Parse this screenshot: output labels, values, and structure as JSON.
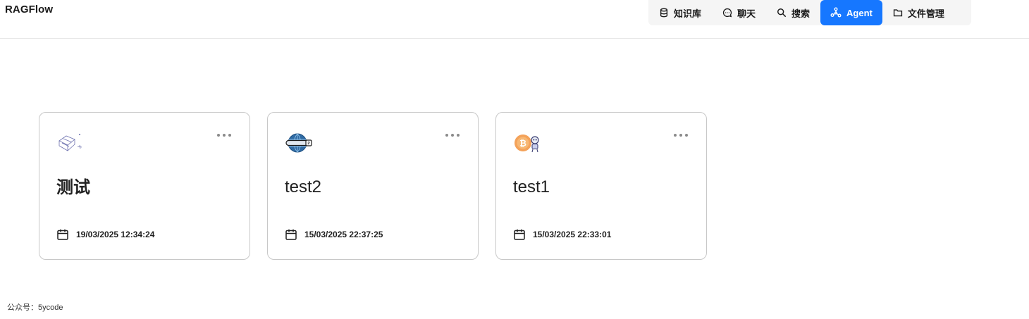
{
  "app": {
    "title": "RAGFlow"
  },
  "nav": {
    "items": [
      {
        "label": "知识库",
        "icon": "database-icon",
        "active": false
      },
      {
        "label": "聊天",
        "icon": "chat-bubble-icon",
        "active": false
      },
      {
        "label": "搜索",
        "icon": "search-icon",
        "active": false
      },
      {
        "label": "Agent",
        "icon": "agent-graph-icon",
        "active": true
      },
      {
        "label": "文件管理",
        "icon": "folder-icon",
        "active": false
      }
    ],
    "accent_color": "#1677ff"
  },
  "agents": [
    {
      "title": "测试",
      "date": "19/03/2025 12:34:24",
      "avatar": "sketch-box-avatar"
    },
    {
      "title": "test2",
      "date": "15/03/2025 22:37:25",
      "avatar": "globe-avatar"
    },
    {
      "title": "test1",
      "date": "15/03/2025 22:33:01",
      "avatar": "coin-robot-avatar"
    }
  ],
  "footer": {
    "note": "公众号：5ycode"
  }
}
